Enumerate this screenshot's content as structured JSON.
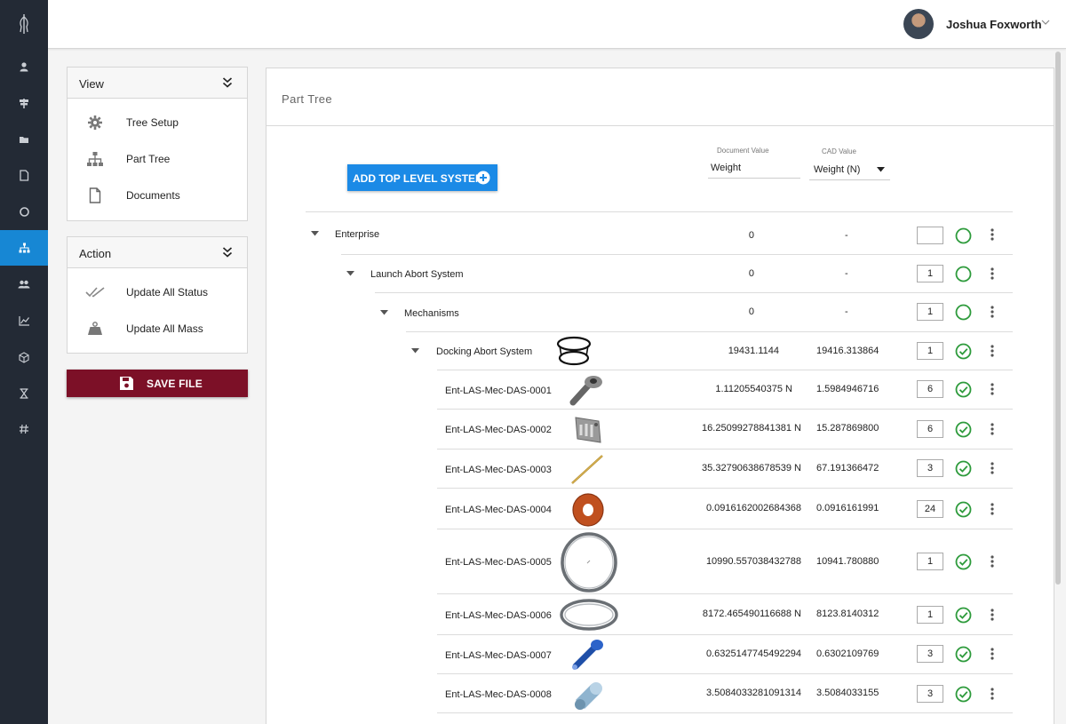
{
  "topbar": {
    "user_name": "Joshua Foxworth"
  },
  "view_panel": {
    "title": "View",
    "items": [
      {
        "label": "Tree Setup",
        "icon": "gear-icon"
      },
      {
        "label": "Part Tree",
        "icon": "hierarchy-icon"
      },
      {
        "label": "Documents",
        "icon": "document-icon"
      }
    ]
  },
  "action_panel": {
    "title": "Action",
    "items": [
      {
        "label": "Update All Status",
        "icon": "double-check-icon"
      },
      {
        "label": "Update All Mass",
        "icon": "weight-icon"
      }
    ]
  },
  "save_button": "SAVE FILE",
  "main": {
    "title": "Part Tree",
    "add_button": "ADD TOP LEVEL SYSTEM",
    "document_value": {
      "label": "Document Value",
      "value": "Weight"
    },
    "cad_value": {
      "label": "CAD Value",
      "selected": "Weight (N)"
    }
  },
  "tree_rows": [
    {
      "name": "Enterprise",
      "doc": "0",
      "cad": "-",
      "qty": "",
      "status": "pending"
    },
    {
      "name": "Launch Abort System",
      "doc": "0",
      "cad": "-",
      "qty": "1",
      "status": "pending"
    },
    {
      "name": "Mechanisms",
      "doc": "0",
      "cad": "-",
      "qty": "1",
      "status": "pending"
    },
    {
      "name": "Docking Abort System",
      "doc": "19431.1144",
      "cad": "19416.313864",
      "qty": "1",
      "status": "complete"
    },
    {
      "name": "Ent-LAS-Mec-DAS-0001",
      "doc": "1.11205540375 N",
      "cad": "1.5984946716",
      "qty": "6",
      "status": "complete"
    },
    {
      "name": "Ent-LAS-Mec-DAS-0002",
      "doc": "16.25099278841381 N",
      "cad": "15.287869800",
      "qty": "6",
      "status": "complete"
    },
    {
      "name": "Ent-LAS-Mec-DAS-0003",
      "doc": "35.32790638678539 N",
      "cad": "67.191366472",
      "qty": "3",
      "status": "complete"
    },
    {
      "name": "Ent-LAS-Mec-DAS-0004",
      "doc": "0.0916162002684368",
      "cad": "0.0916161991",
      "qty": "24",
      "status": "complete"
    },
    {
      "name": "Ent-LAS-Mec-DAS-0005",
      "doc": "10990.557038432788",
      "cad": "10941.780880",
      "qty": "1",
      "status": "complete"
    },
    {
      "name": "Ent-LAS-Mec-DAS-0006",
      "doc": "8172.465490116688 N",
      "cad": "8123.8140312",
      "qty": "1",
      "status": "complete"
    },
    {
      "name": "Ent-LAS-Mec-DAS-0007",
      "doc": "0.6325147745492294",
      "cad": "0.6302109769",
      "qty": "3",
      "status": "complete"
    },
    {
      "name": "Ent-LAS-Mec-DAS-0008",
      "doc": "3.5084033281091314",
      "cad": "3.5084033155",
      "qty": "3",
      "status": "complete"
    }
  ]
}
